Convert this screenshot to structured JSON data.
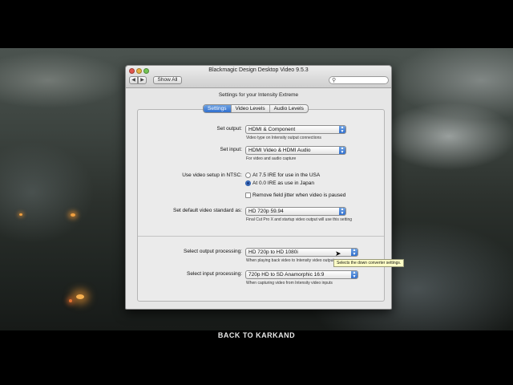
{
  "window": {
    "title": "Blackmagic Design Desktop Video 9.5.3",
    "show_all": "Show All",
    "back_glyph": "◀",
    "forward_glyph": "▶",
    "search": {
      "placeholder": "",
      "icon": "magnifier-icon"
    }
  },
  "panel": {
    "heading": "Settings for your Intensity Extreme",
    "tabs": [
      {
        "label": "Settings",
        "active": true
      },
      {
        "label": "Video Levels",
        "active": false
      },
      {
        "label": "Audio Levels",
        "active": false
      }
    ]
  },
  "settings": {
    "output": {
      "label": "Set output:",
      "value": "HDMI & Component",
      "help": "Video type on Intensity output connections"
    },
    "input": {
      "label": "Set input:",
      "value": "HDMI Video & HDMI Audio",
      "help": "For video and audio capture"
    },
    "ntsc": {
      "label": "Use video setup in NTSC:",
      "option_1": "At 7.5 IRE for use in the USA",
      "option_2": "At 0.0 IRE as use in Japan",
      "selected": 2
    },
    "jitter": {
      "label": "Remove field jitter when video is paused",
      "checked": false
    },
    "standard": {
      "label": "Set default video standard as:",
      "value": "HD 720p 59.94",
      "help": "Final Cut Pro X and startup video output will use this setting"
    },
    "output_processing": {
      "label": "Select output processing:",
      "value": "HD 720p to HD 1080i",
      "help": "When playing back video to Intensity video outputs"
    },
    "input_processing": {
      "label": "Select input processing:",
      "value": "720p HD to SD Anamorphic 16:9",
      "help": "When capturing video from Intensity video inputs"
    }
  },
  "tooltip": "Selects the down converter settings.",
  "video_subtitle": "BACK TO KARKAND",
  "colors": {
    "accent": "#2f6fcf",
    "tooltip_bg": "#ffffc7"
  }
}
